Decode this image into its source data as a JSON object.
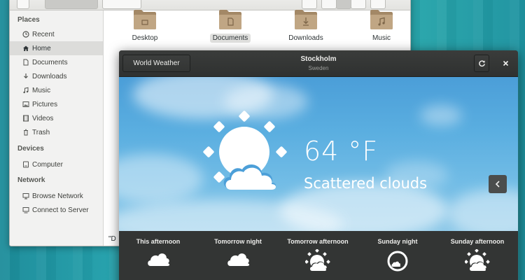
{
  "files": {
    "sidebar": {
      "sections": [
        {
          "title": "Places",
          "items": [
            {
              "label": "Recent",
              "icon": "clock-icon"
            },
            {
              "label": "Home",
              "icon": "home-icon",
              "active": true
            },
            {
              "label": "Documents",
              "icon": "document-icon"
            },
            {
              "label": "Downloads",
              "icon": "download-icon"
            },
            {
              "label": "Music",
              "icon": "music-icon"
            },
            {
              "label": "Pictures",
              "icon": "picture-icon"
            },
            {
              "label": "Videos",
              "icon": "video-icon"
            },
            {
              "label": "Trash",
              "icon": "trash-icon"
            }
          ]
        },
        {
          "title": "Devices",
          "items": [
            {
              "label": "Computer",
              "icon": "computer-icon"
            }
          ]
        },
        {
          "title": "Network",
          "items": [
            {
              "label": "Browse Network",
              "icon": "network-icon"
            },
            {
              "label": "Connect to Server",
              "icon": "server-icon"
            }
          ]
        }
      ]
    },
    "folders": [
      {
        "label": "Desktop",
        "icon": "folder-desktop-icon"
      },
      {
        "label": "Documents",
        "icon": "folder-documents-icon",
        "selected": true
      },
      {
        "label": "Downloads",
        "icon": "folder-downloads-icon"
      },
      {
        "label": "Music",
        "icon": "folder-music-icon"
      }
    ],
    "partial_label": "\"D"
  },
  "weather": {
    "world_button": "World Weather",
    "city": "Stockholm",
    "country": "Sweden",
    "temperature": "64 °F",
    "condition": "Scattered clouds",
    "forecast": [
      {
        "label": "This afternoon",
        "icon": "cloud-icon"
      },
      {
        "label": "Tomorrow night",
        "icon": "cloud-icon"
      },
      {
        "label": "Tomorrow afternoon",
        "icon": "sun-cloud-icon"
      },
      {
        "label": "Sunday night",
        "icon": "moon-icon"
      },
      {
        "label": "Sunday afternoon",
        "icon": "sun-cloud-icon"
      }
    ]
  },
  "colors": {
    "desktop": "#2aa9ad",
    "sky_top": "#4b9ed8",
    "weather_header": "#3a3c3b",
    "forecast_bar": "#333534",
    "folder": "#a38866"
  }
}
